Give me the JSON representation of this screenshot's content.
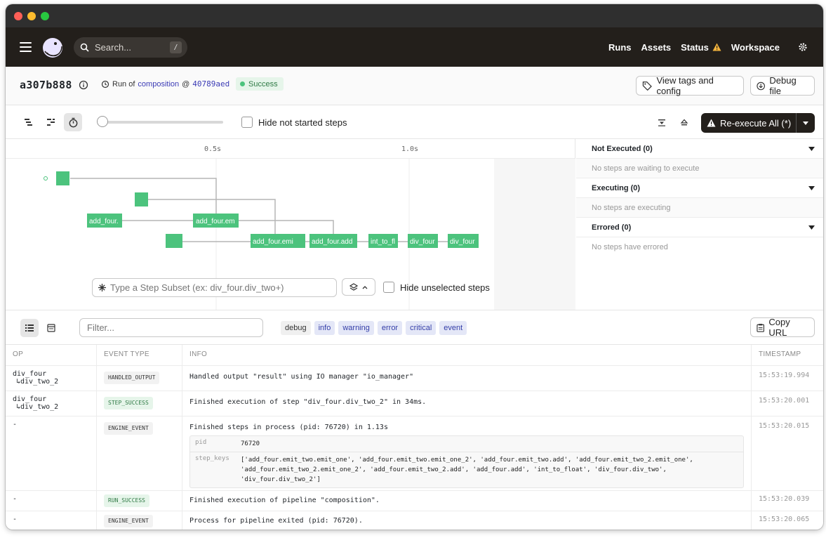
{
  "search": {
    "placeholder": "Search...",
    "shortcut": "/"
  },
  "nav": {
    "runs": "Runs",
    "assets": "Assets",
    "status": "Status",
    "workspace": "Workspace"
  },
  "run": {
    "id": "a307b888",
    "run_of_label": "Run of",
    "pipeline": "composition",
    "at": "@",
    "snapshot": "40789aed",
    "status": "Success",
    "status_color": "#4cc37d"
  },
  "header_buttons": {
    "view_tags": "View tags and config",
    "debug_file": "Debug file"
  },
  "toolbar": {
    "hide_not_started": "Hide not started steps",
    "reexecute": "Re-execute All (*)"
  },
  "gantt": {
    "scale": [
      "0.5s",
      "1.0s"
    ],
    "steps": [
      "add_four.",
      "add_four.em",
      "add_four.emi",
      "add_four.add",
      "int_to_fl",
      "div_four",
      "div_four"
    ],
    "step_color": "#4cc37d"
  },
  "step_subset": {
    "placeholder": "Type a Step Subset (ex: div_four.div_two+)",
    "hide_unselected": "Hide unselected steps"
  },
  "side_panel": [
    {
      "title": "Not Executed (0)",
      "empty": "No steps are waiting to execute"
    },
    {
      "title": "Executing (0)",
      "empty": "No steps are executing"
    },
    {
      "title": "Errored (0)",
      "empty": "No steps have errored"
    }
  ],
  "logs": {
    "filter_placeholder": "Filter...",
    "levels": [
      "debug",
      "info",
      "warning",
      "error",
      "critical",
      "event"
    ],
    "copy_url": "Copy URL",
    "columns": [
      "OP",
      "EVENT TYPE",
      "INFO",
      "TIMESTAMP"
    ],
    "rows": [
      {
        "op": "div_four",
        "op_sub": "↳div_two_2",
        "event": "HANDLED_OUTPUT",
        "info": "Handled output \"result\" using IO manager \"io_manager\"",
        "ts": "15:53:19.994"
      },
      {
        "op": "div_four",
        "op_sub": "↳div_two_2",
        "event": "STEP_SUCCESS",
        "info": "Finished execution of step \"div_four.div_two_2\" in 34ms.",
        "ts": "15:53:20.001"
      },
      {
        "op": "-",
        "op_sub": "",
        "event": "ENGINE_EVENT",
        "info": "Finished steps in process (pid: 76720) in 1.13s",
        "ts": "15:53:20.015",
        "kv": [
          {
            "k": "pid",
            "v": "76720"
          },
          {
            "k": "step_keys",
            "v": "['add_four.emit_two.emit_one', 'add_four.emit_two.emit_one_2', 'add_four.emit_two.add', 'add_four.emit_two_2.emit_one', 'add_four.emit_two_2.emit_one_2', 'add_four.emit_two_2.add', 'add_four.add', 'int_to_float', 'div_four.div_two', 'div_four.div_two_2']"
          }
        ]
      },
      {
        "op": "-",
        "op_sub": "",
        "event": "RUN_SUCCESS",
        "info": "Finished execution of pipeline \"composition\".",
        "ts": "15:53:20.039"
      },
      {
        "op": "-",
        "op_sub": "",
        "event": "ENGINE_EVENT",
        "info": "Process for pipeline exited (pid: 76720).",
        "ts": "15:53:20.065"
      }
    ]
  }
}
